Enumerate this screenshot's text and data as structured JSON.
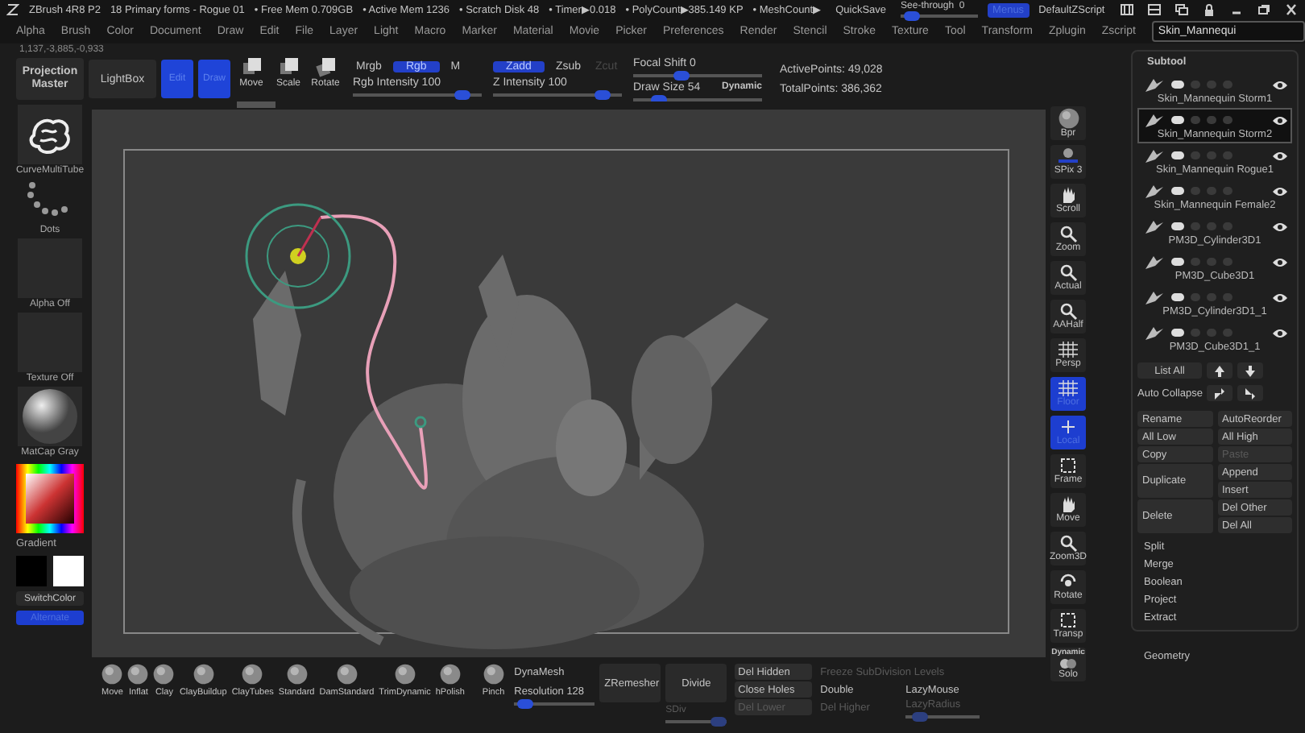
{
  "title_bar": {
    "app": "ZBrush 4R8 P2",
    "document": "18 Primary forms - Rogue 01",
    "stats": [
      "• Free Mem 0.709GB",
      "• Active Mem 1236",
      "• Scratch Disk 48",
      "• Timer▶0.018",
      "• PolyCount▶385.149 KP",
      "• MeshCount▶"
    ],
    "quicksave": "QuickSave",
    "see_through": {
      "label": "See-through",
      "value": "0",
      "level": 0.05
    },
    "menus_button": {
      "label": "Menus",
      "on": true
    },
    "default_script": "DefaultZScript"
  },
  "menus": [
    "Alpha",
    "Brush",
    "Color",
    "Document",
    "Draw",
    "Edit",
    "File",
    "Layer",
    "Light",
    "Macro",
    "Marker",
    "Material",
    "Movie",
    "Picker",
    "Preferences",
    "Render",
    "Stencil",
    "Stroke",
    "Texture",
    "Tool",
    "Transform",
    "Zplugin",
    "Zscript"
  ],
  "subtool_search": {
    "value": "Skin_Mannequi"
  },
  "coordinates": "1,137,-3,885,-0,933",
  "toolbar": {
    "projection_master": "Projection Master",
    "lightbox": "LightBox",
    "tools": [
      {
        "label": "Edit",
        "kind": "mode",
        "selected": true
      },
      {
        "label": "Draw",
        "kind": "mode",
        "selected": true
      },
      {
        "label": "Move",
        "kind": "move",
        "selected": false
      },
      {
        "label": "Scale",
        "kind": "scale",
        "selected": false
      },
      {
        "label": "Rotate",
        "kind": "rotate",
        "selected": false
      }
    ],
    "color_modes": [
      {
        "label": "Mrgb",
        "selected": false
      },
      {
        "label": "Rgb",
        "selected": true
      },
      {
        "label": "M",
        "selected": false
      }
    ],
    "depth_modes": [
      {
        "label": "Zadd",
        "selected": true,
        "disabled": false
      },
      {
        "label": "Zsub",
        "selected": false,
        "disabled": false
      },
      {
        "label": "Zcut",
        "selected": false,
        "disabled": true
      }
    ],
    "sliders": [
      {
        "label": "Rgb Intensity",
        "value": "100",
        "level": 0.9
      },
      {
        "label": "Z Intensity",
        "value": "100",
        "level": 0.9
      },
      {
        "label": "Focal Shift",
        "value": "0",
        "level": 0.35
      },
      {
        "label": "Draw Size",
        "value": "54",
        "level": 0.15
      }
    ],
    "dynamic": "Dynamic",
    "stats": [
      "ActivePoints: 49,028",
      "TotalPoints: 386,362"
    ]
  },
  "shelf": [
    {
      "kind": "brush",
      "label": "CurveMultiTube"
    },
    {
      "kind": "stroke",
      "label": "Dots"
    },
    {
      "kind": "alpha",
      "label": "Alpha Off"
    },
    {
      "kind": "texture",
      "label": "Texture Off"
    },
    {
      "kind": "material",
      "label": "MatCap Gray"
    }
  ],
  "color_picker": {
    "gradient": "Gradient",
    "swatches": [
      {
        "color": "#000000"
      },
      {
        "color": "#ffffff"
      }
    ],
    "switch": "SwitchColor",
    "alternate": {
      "label": "Alternate",
      "on": true
    }
  },
  "view_buttons": [
    {
      "label": "Bpr",
      "kind": "sphere",
      "selected": false
    },
    {
      "label": "SPix 3",
      "kind": "slider",
      "selected": false
    },
    {
      "label": "Scroll",
      "kind": "hand",
      "selected": false
    },
    {
      "label": "Zoom",
      "kind": "zoom",
      "selected": false
    },
    {
      "label": "Actual",
      "kind": "zoom",
      "selected": false
    },
    {
      "label": "AAHalf",
      "kind": "zoom",
      "selected": false
    },
    {
      "label": "Persp",
      "kind": "grid",
      "selected": false
    },
    {
      "label": "Floor",
      "kind": "grid",
      "selected": true
    },
    {
      "label": "Local",
      "kind": "axis",
      "selected": true
    },
    {
      "label": "Frame",
      "kind": "frame",
      "selected": false
    },
    {
      "label": "Move",
      "kind": "hand",
      "selected": false
    },
    {
      "label": "Zoom3D",
      "kind": "zoom",
      "selected": false
    },
    {
      "label": "Rotate",
      "kind": "rotate",
      "selected": false
    },
    {
      "label": "Transp",
      "kind": "frame",
      "selected": false
    },
    {
      "label": "Solo",
      "kind": "solo",
      "selected": false,
      "badge": "Dynamic"
    }
  ],
  "subtool": {
    "title": "Subtool",
    "items": [
      {
        "name": "Skin_Mannequin Storm1",
        "selected": false,
        "visible": true
      },
      {
        "name": "Skin_Mannequin Storm2",
        "selected": true,
        "visible": true
      },
      {
        "name": "Skin_Mannequin Rogue1",
        "selected": false,
        "visible": true
      },
      {
        "name": "Skin_Mannequin Female2",
        "selected": false,
        "visible": true
      },
      {
        "name": "PM3D_Cylinder3D1",
        "selected": false,
        "visible": true
      },
      {
        "name": "PM3D_Cube3D1",
        "selected": false,
        "visible": true
      },
      {
        "name": "PM3D_Cylinder3D1_1",
        "selected": false,
        "visible": true
      },
      {
        "name": "PM3D_Cube3D1_1",
        "selected": false,
        "visible": true
      }
    ],
    "list_all": "List All",
    "auto_collapse": "Auto Collapse",
    "actions": [
      {
        "label": "Rename",
        "kind": "left",
        "disabled": false
      },
      {
        "label": "AutoReorder",
        "kind": "right",
        "disabled": false
      },
      {
        "label": "All Low",
        "kind": "left",
        "disabled": false
      },
      {
        "label": "All High",
        "kind": "right",
        "disabled": false
      },
      {
        "label": "Copy",
        "kind": "left",
        "disabled": false
      },
      {
        "label": "Paste",
        "kind": "right",
        "disabled": true
      },
      {
        "label": "Append",
        "kind": "right",
        "disabled": false
      },
      {
        "label": "Duplicate",
        "kind": "tall",
        "disabled": false
      },
      {
        "label": "Insert",
        "kind": "right",
        "disabled": false
      },
      {
        "label": "Del Other",
        "kind": "right",
        "disabled": false
      },
      {
        "label": "Delete",
        "kind": "tall",
        "disabled": false
      },
      {
        "label": "Del All",
        "kind": "right",
        "disabled": false
      }
    ],
    "functions": [
      "Split",
      "Merge",
      "Boolean",
      "Project",
      "Extract"
    ],
    "geometry": "Geometry"
  },
  "brushes": [
    "Move",
    "Inflat",
    "Clay",
    "ClayBuildup",
    "ClayTubes",
    "Standard",
    "DamStandard",
    "TrimDynamic",
    "hPolish",
    "Pinch"
  ],
  "dynamesh": {
    "label": "DynaMesh",
    "resolution": {
      "label": "Resolution",
      "value": "128",
      "level": 0.05
    }
  },
  "geometry_buttons": [
    "ZRemesher",
    "Divide"
  ],
  "sdiv": {
    "label": "SDiv",
    "level": 1,
    "disabled": true
  },
  "geometry_options": [
    {
      "label": "Del Hidden",
      "kind": "button",
      "disabled": false
    },
    {
      "label": "Freeze SubDivision Levels",
      "kind": "wide",
      "disabled": true
    },
    {
      "label": "Close Holes",
      "kind": "button",
      "disabled": false
    },
    {
      "label": "Double",
      "kind": "text",
      "disabled": false
    },
    {
      "label": "LazyMouse",
      "kind": "text",
      "disabled": false
    },
    {
      "label": "Del Lower",
      "kind": "button",
      "disabled": true
    },
    {
      "label": "Del Higher",
      "kind": "text",
      "disabled": true
    },
    {
      "label": "LazyRadius",
      "kind": "slider",
      "disabled": true,
      "level": 0.1
    }
  ]
}
